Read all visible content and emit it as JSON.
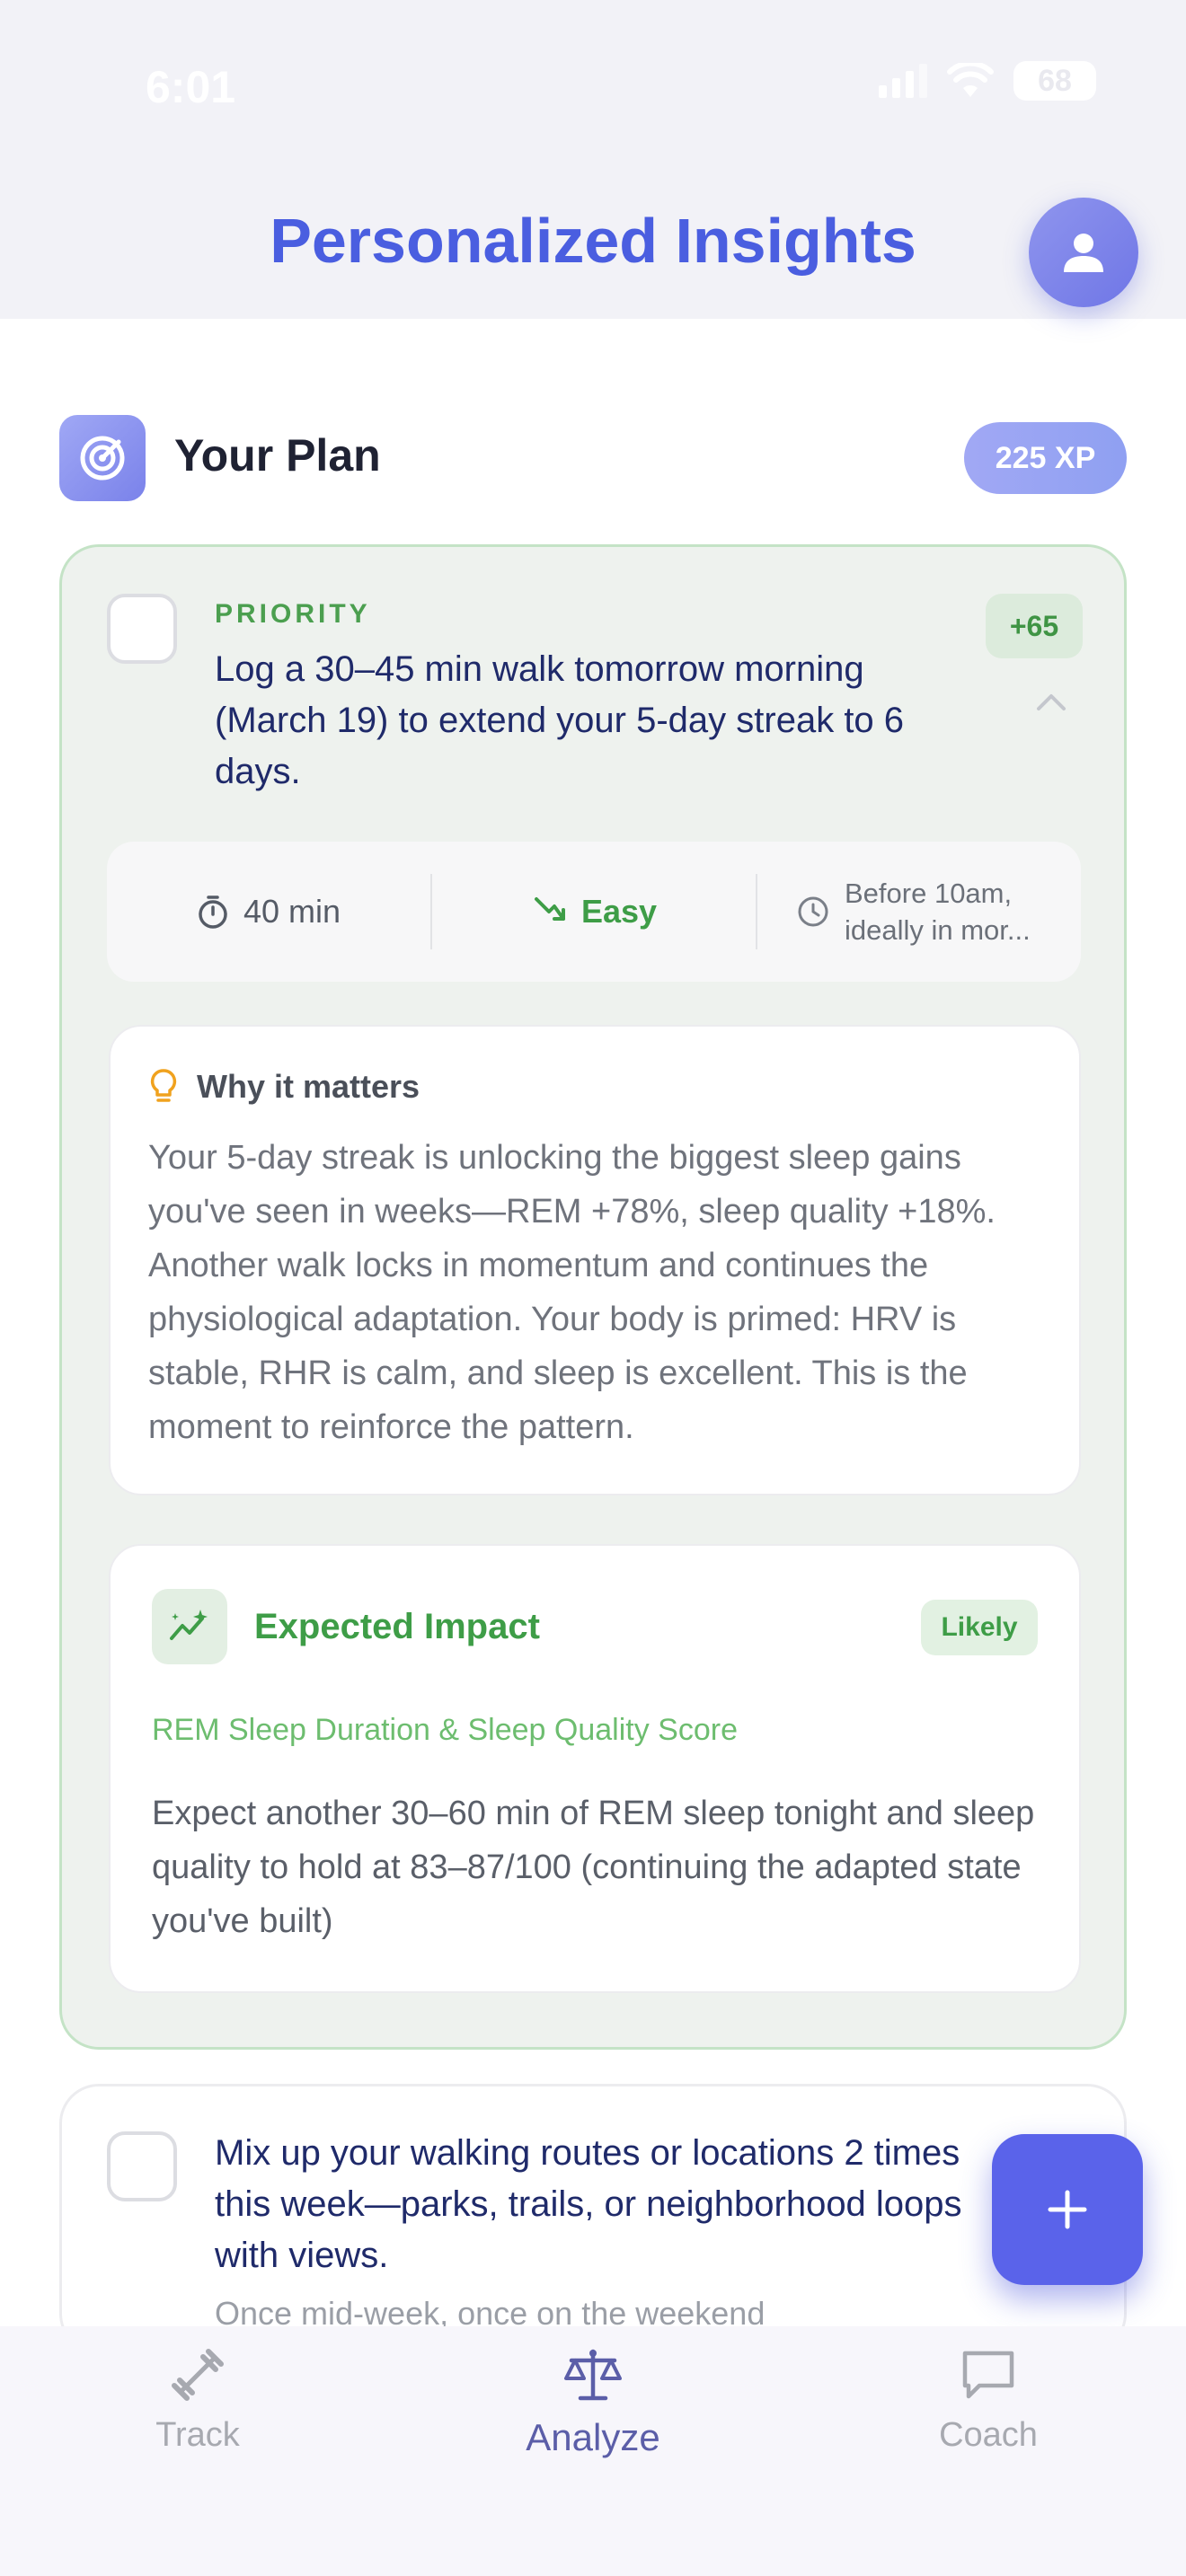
{
  "status_bar": {
    "time": "6:01",
    "battery": "68"
  },
  "header": {
    "title": "Personalized Insights"
  },
  "plan": {
    "title": "Your Plan",
    "xp": "225 XP"
  },
  "priority_card": {
    "label": "PRIORITY",
    "points": "+65",
    "task": "Log a 30–45 min walk tomorrow morning (March 19) to extend your 5-day streak to 6 days.",
    "stats": {
      "duration": "40 min",
      "difficulty": "Easy",
      "timing": "Before 10am, ideally in mor..."
    },
    "why": {
      "title": "Why it matters",
      "body": "Your 5-day streak is unlocking the biggest sleep gains you've seen in weeks—REM +78%, sleep quality +18%. Another walk locks in momentum and continues the physiological adaptation. Your body is primed: HRV is stable, RHR is calm, and sleep is excellent. This is the moment to reinforce the pattern."
    },
    "impact": {
      "title": "Expected Impact",
      "badge": "Likely",
      "metric": "REM Sleep Duration & Sleep Quality Score",
      "body": "Expect another 30–60 min of REM sleep tonight and sleep quality to hold at 83–87/100 (continuing the adapted state you've built)"
    }
  },
  "second_card": {
    "task": "Mix up your walking routes or locations 2 times this week—parks, trails, or neighborhood loops with views.",
    "subtitle": "Once mid-week, once on the weekend"
  },
  "tabbar": {
    "tabs": [
      {
        "label": "Track"
      },
      {
        "label": "Analyze"
      },
      {
        "label": "Coach"
      }
    ],
    "active": "Analyze"
  },
  "colors": {
    "accent": "#4a5ee0",
    "fab": "#5a63ea",
    "success": "#3e9d47",
    "card_bg": "#eef2ee"
  }
}
